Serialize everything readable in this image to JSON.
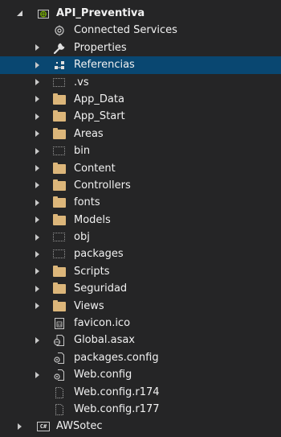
{
  "tree": {
    "root": {
      "label": "API_Preventiva",
      "icon": "web-project-icon",
      "expanded": true
    },
    "children": [
      {
        "label": "Connected Services",
        "icon": "connected-services-icon",
        "has_arrow": false
      },
      {
        "label": "Properties",
        "icon": "wrench-icon",
        "has_arrow": true
      },
      {
        "label": "Referencias",
        "icon": "references-icon",
        "has_arrow": true,
        "selected": true
      },
      {
        "label": ".vs",
        "icon": "hidden-folder-icon",
        "has_arrow": true
      },
      {
        "label": "App_Data",
        "icon": "folder-icon",
        "has_arrow": true
      },
      {
        "label": "App_Start",
        "icon": "folder-icon",
        "has_arrow": true
      },
      {
        "label": "Areas",
        "icon": "folder-icon",
        "has_arrow": true
      },
      {
        "label": "bin",
        "icon": "hidden-folder-icon",
        "has_arrow": true
      },
      {
        "label": "Content",
        "icon": "folder-icon",
        "has_arrow": true
      },
      {
        "label": "Controllers",
        "icon": "folder-icon",
        "has_arrow": true
      },
      {
        "label": "fonts",
        "icon": "folder-icon",
        "has_arrow": true
      },
      {
        "label": "Models",
        "icon": "folder-icon",
        "has_arrow": true
      },
      {
        "label": "obj",
        "icon": "hidden-folder-icon",
        "has_arrow": true
      },
      {
        "label": "packages",
        "icon": "hidden-folder-icon",
        "has_arrow": true
      },
      {
        "label": "Scripts",
        "icon": "folder-icon",
        "has_arrow": true
      },
      {
        "label": "Seguridad",
        "icon": "folder-icon",
        "has_arrow": true
      },
      {
        "label": "Views",
        "icon": "folder-icon",
        "has_arrow": true
      },
      {
        "label": "favicon.ico",
        "icon": "image-file-icon",
        "has_arrow": false
      },
      {
        "label": "Global.asax",
        "icon": "global-asax-icon",
        "has_arrow": true
      },
      {
        "label": "packages.config",
        "icon": "config-file-icon",
        "has_arrow": false
      },
      {
        "label": "Web.config",
        "icon": "config-file-icon",
        "has_arrow": true
      },
      {
        "label": "Web.config.r174",
        "icon": "file-icon",
        "has_arrow": false
      },
      {
        "label": "Web.config.r177",
        "icon": "file-icon",
        "has_arrow": false
      }
    ],
    "sibling_root": {
      "label": "AWSotec",
      "icon": "csharp-project-icon",
      "badge": "C#",
      "expanded": false
    }
  },
  "colors": {
    "background": "#252526",
    "selection": "#094771",
    "folder": "#dcb67a",
    "text": "#f1f1f1"
  }
}
